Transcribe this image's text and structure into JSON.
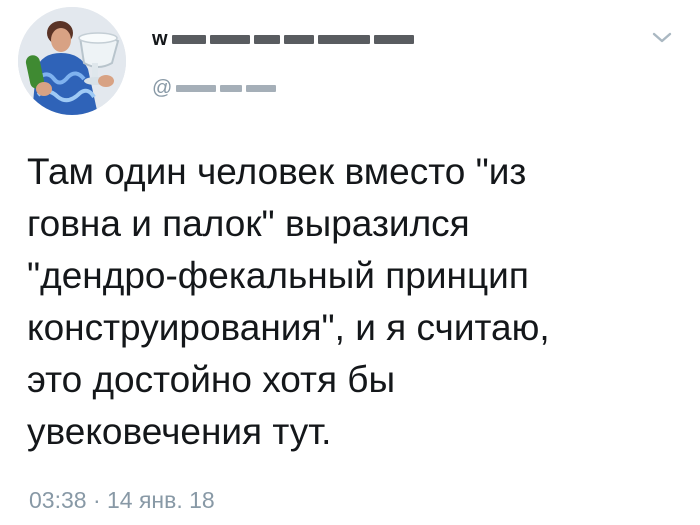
{
  "author": {
    "display_name_visible": "w",
    "handle_prefix": "@"
  },
  "icons": {
    "menu": "chevron-down-icon",
    "avatar": "profile-avatar"
  },
  "tweet": {
    "text_lines": [
      "Там один человек вместо \"из",
      "говна и палок\" выразился",
      "\"дендро-фекальный принцип",
      "конструирования\", и я считаю,",
      "это достойно хотя бы",
      "увековечения тут."
    ],
    "timestamp": "03:38 · 14 янв. 18"
  },
  "colors": {
    "text": "#14171a",
    "secondary": "#8899a6",
    "background": "#ffffff"
  }
}
